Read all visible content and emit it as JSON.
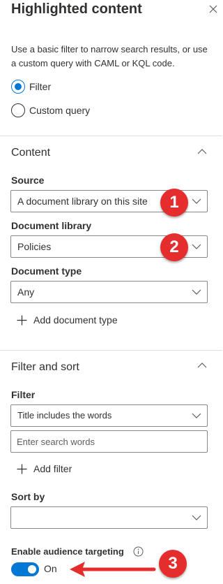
{
  "header": {
    "title": "Highlighted content",
    "close_icon": "close-icon"
  },
  "intro_text": "Use a basic filter to narrow search results, or use a custom query with CAML or KQL code.",
  "mode": {
    "options": [
      {
        "label": "Filter",
        "selected": true
      },
      {
        "label": "Custom query",
        "selected": false
      }
    ]
  },
  "content_section": {
    "title": "Content",
    "source": {
      "label": "Source",
      "value": "A document library on this site"
    },
    "document_library": {
      "label": "Document library",
      "value": "Policies"
    },
    "document_type": {
      "label": "Document type",
      "value": "Any"
    },
    "add_document_type": "Add document type"
  },
  "filter_section": {
    "title": "Filter and sort",
    "filter": {
      "label": "Filter",
      "value": "Title includes the words"
    },
    "search_placeholder": "Enter search words",
    "add_filter": "Add filter",
    "sort_by": {
      "label": "Sort by",
      "value": ""
    },
    "audience_targeting": {
      "label": "Enable audience targeting",
      "state": "On",
      "enabled": true
    }
  },
  "annotations": [
    "1",
    "2",
    "3"
  ],
  "colors": {
    "accent": "#0078d4",
    "callout": "#e52d2d",
    "text": "#323130",
    "border": "#8a8886"
  }
}
